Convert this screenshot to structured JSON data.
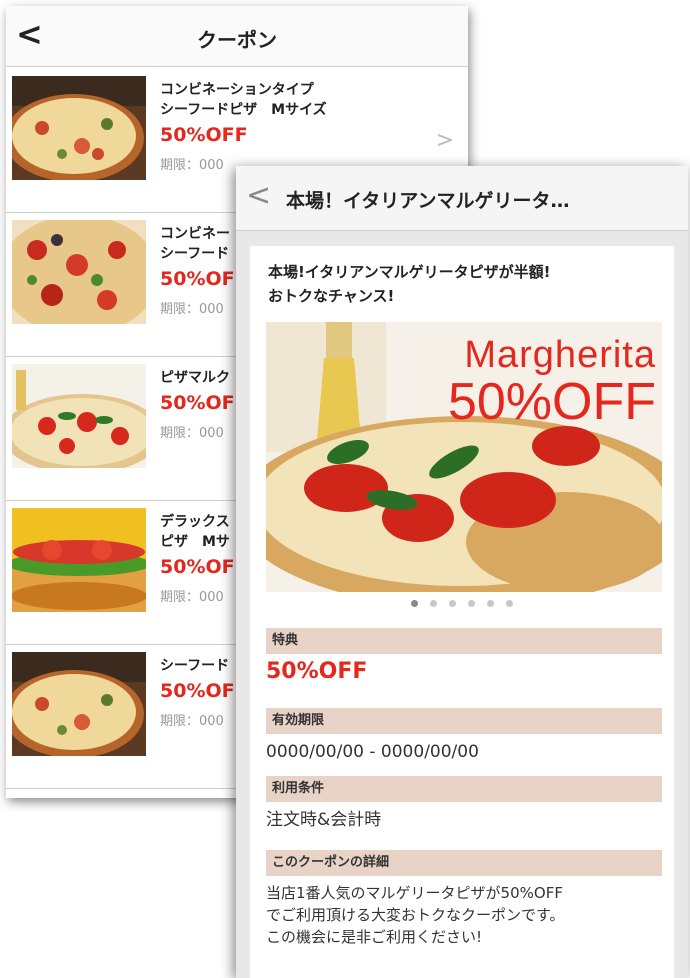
{
  "list_screen": {
    "back_icon": "chevron-left-icon",
    "title": "クーポン",
    "coupons": [
      {
        "name": "コンビネーションタイプ\nシーフードピザ　Mサイズ",
        "discount": "50%OFF",
        "expiry": "期限：000"
      },
      {
        "name": "コンビネー\nシーフード",
        "discount": "50%OFF",
        "expiry": "期限：000"
      },
      {
        "name": "ピザマルク",
        "discount": "50%OFF",
        "expiry": "期限：000"
      },
      {
        "name": "デラックス\nピザ　Mサ",
        "discount": "50%OFF",
        "expiry": "期限：000"
      },
      {
        "name": "シーフード",
        "discount": "50%OFF",
        "expiry": "期限：000"
      }
    ]
  },
  "detail_screen": {
    "back_icon": "chevron-left-icon",
    "title": "本場！イタリアンマルゲリータ…",
    "headline": "本場!イタリアンマルゲリータピザが半額!\nおトクなチャンス!",
    "hero": {
      "line1": "Margherita",
      "line2": "50%OFF"
    },
    "carousel": {
      "count": 6,
      "active_index": 0
    },
    "sections": {
      "benefit": {
        "label": "特典",
        "value": "50%OFF"
      },
      "validity": {
        "label": "有効期限",
        "value": "0000/00/00 - 0000/00/00"
      },
      "conditions": {
        "label": "利用条件",
        "value": "注文時&会計時"
      },
      "details": {
        "label": "このクーポンの詳細",
        "value": "当店1番人気のマルゲリータピザが50%OFF\nでご利用頂ける大変おトクなクーポンです。\nこの機会に是非ご利用ください!"
      }
    }
  },
  "colors": {
    "accent_red": "#e5271d",
    "section_bar": "#e9d2c6"
  }
}
